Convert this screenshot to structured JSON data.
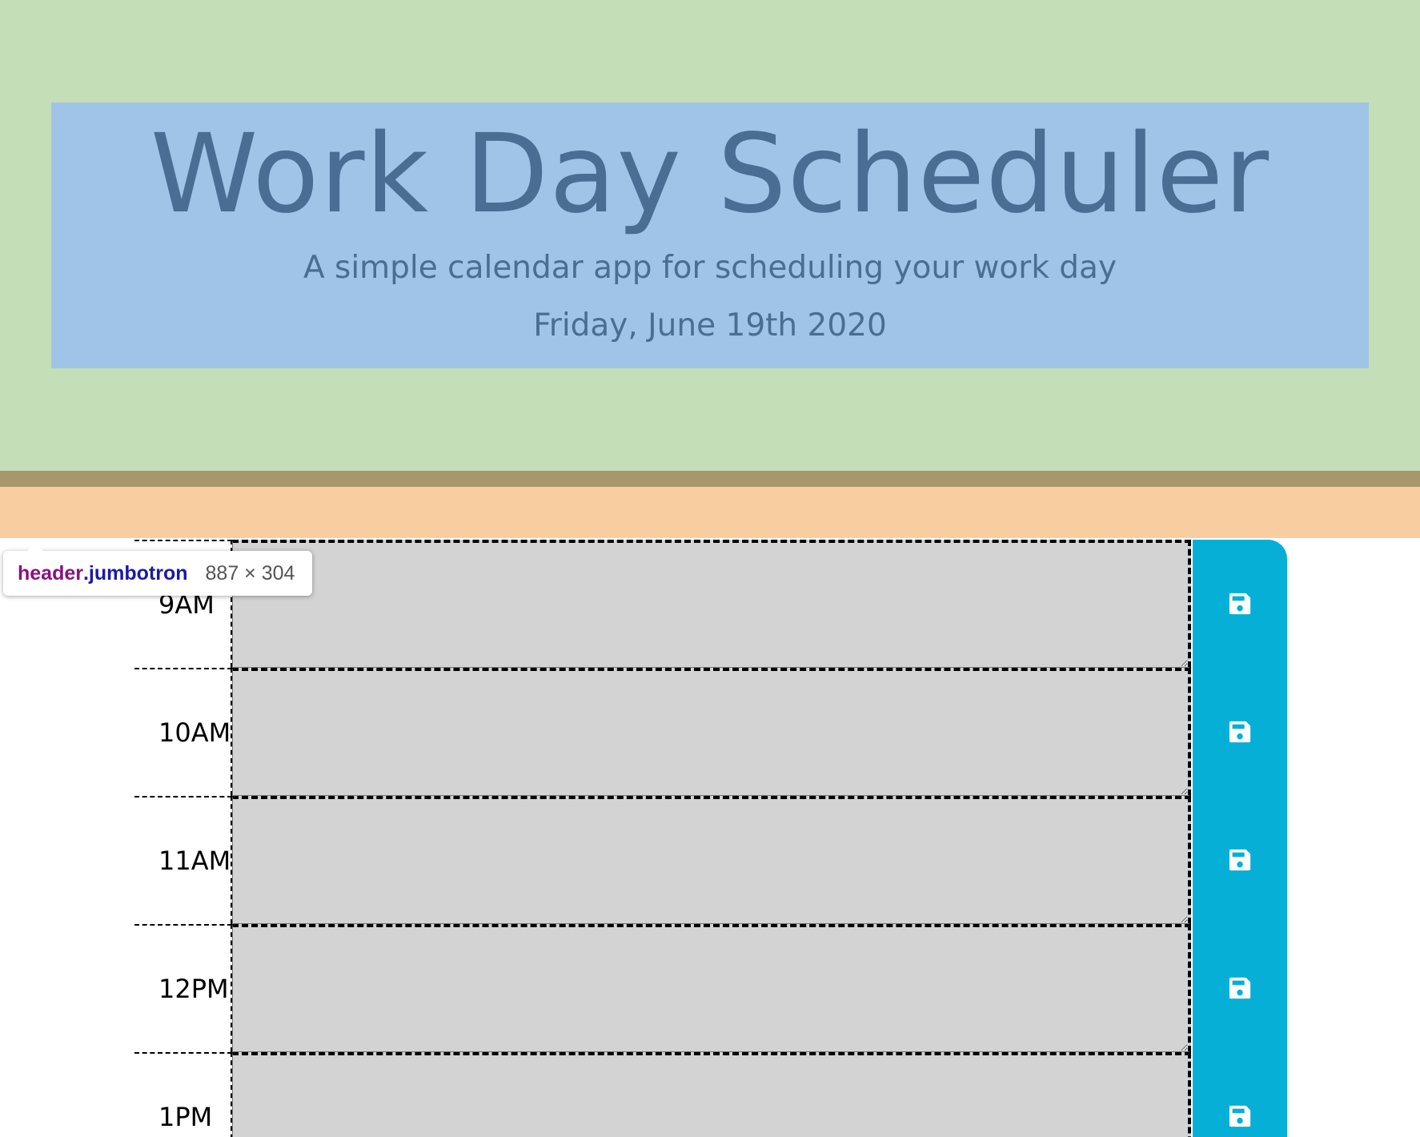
{
  "header": {
    "title": "Work Day Scheduler",
    "lead": "A simple calendar app for scheduling your work day",
    "current_day": "Friday, June 19th 2020"
  },
  "devtools_tooltip": {
    "tag": "header",
    "class": ".jumbotron",
    "dimensions": "887 × 304"
  },
  "schedule": {
    "rows": [
      {
        "hour": "9AM",
        "description": ""
      },
      {
        "hour": "10AM",
        "description": ""
      },
      {
        "hour": "11AM",
        "description": ""
      },
      {
        "hour": "12PM",
        "description": ""
      },
      {
        "hour": "1PM",
        "description": ""
      }
    ],
    "save_icon": "floppy-disk-icon"
  },
  "colors": {
    "margin_overlay": "#c4dfb7",
    "jumbotron": "#a0c4e8",
    "border_strip": "#a7976a",
    "padding_strip": "#f8cda0",
    "time_block": "#d3d3d3",
    "save_button": "#06afd6"
  }
}
